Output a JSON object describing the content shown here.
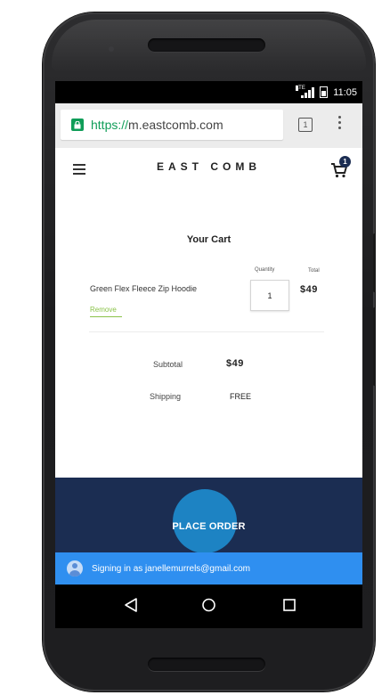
{
  "status_bar": {
    "network": "LTE",
    "time": "11:05"
  },
  "browser": {
    "url_scheme": "https://",
    "url_host": "m.eastcomb.com",
    "tab_count": "1"
  },
  "site": {
    "brand": "EAST COMB",
    "cart_badge": "1"
  },
  "cart": {
    "title": "Your Cart",
    "quantity_header": "Quantity",
    "total_header": "Total",
    "items": [
      {
        "name": "Green Flex Fleece Zip Hoodie",
        "remove_label": "Remove",
        "quantity": "1",
        "total": "$49"
      }
    ],
    "subtotal_label": "Subtotal",
    "subtotal_value": "$49",
    "shipping_label": "Shipping",
    "shipping_value": "FREE"
  },
  "checkout": {
    "place_order_label": "PLACE ORDER",
    "signin_text": "Signing in as janellemurrels@gmail.com"
  },
  "colors": {
    "brand_navy": "#1b2d52",
    "signin_blue": "#2f8ff0",
    "ripple_blue": "#1e88c9",
    "remove_green": "#8bc34a",
    "secure_green": "#0f9d58"
  }
}
